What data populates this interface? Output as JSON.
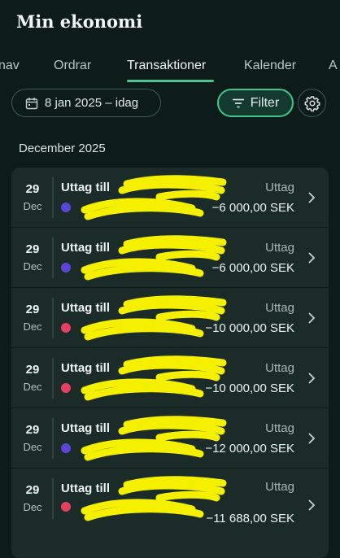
{
  "app": {
    "title": "Min ekonomi"
  },
  "tabs": [
    {
      "label": "nav"
    },
    {
      "label": "Ordrar"
    },
    {
      "label": "Transaktioner",
      "active": true
    },
    {
      "label": "Kalender"
    },
    {
      "label": "A"
    }
  ],
  "toolbar": {
    "date_range": "8 jan 2025 – idag",
    "filter_label": "Filter"
  },
  "section": {
    "heading": "December 2025"
  },
  "colors": {
    "accent": "#41c68e",
    "dot_purple": "#5b45d6",
    "dot_red": "#e5405f",
    "redaction": "#f5f000"
  },
  "transactions": [
    {
      "day": "29",
      "month": "Dec",
      "description": "Uttag till",
      "account": "",
      "dot": "purple",
      "type": "Uttag",
      "amount": "−6 000,00 SEK"
    },
    {
      "day": "29",
      "month": "Dec",
      "description": "Uttag till",
      "account": "",
      "dot": "purple",
      "type": "Uttag",
      "amount": "−6 000,00 SEK"
    },
    {
      "day": "29",
      "month": "Dec",
      "description": "Uttag till",
      "account": "",
      "dot": "red",
      "type": "Uttag",
      "amount": "−10 000,00 SEK"
    },
    {
      "day": "29",
      "month": "Dec",
      "description": "Uttag till",
      "account": "",
      "dot": "red",
      "type": "Uttag",
      "amount": "−10 000,00 SEK"
    },
    {
      "day": "29",
      "month": "Dec",
      "description": "Uttag till",
      "account": "",
      "dot": "purple",
      "type": "Uttag",
      "amount": "−12 000,00 SEK"
    },
    {
      "day": "29",
      "month": "Dec",
      "description": "Uttag till",
      "account": "",
      "dot": "red",
      "type": "Uttag",
      "amount": "−11 688,00 SEK"
    }
  ]
}
